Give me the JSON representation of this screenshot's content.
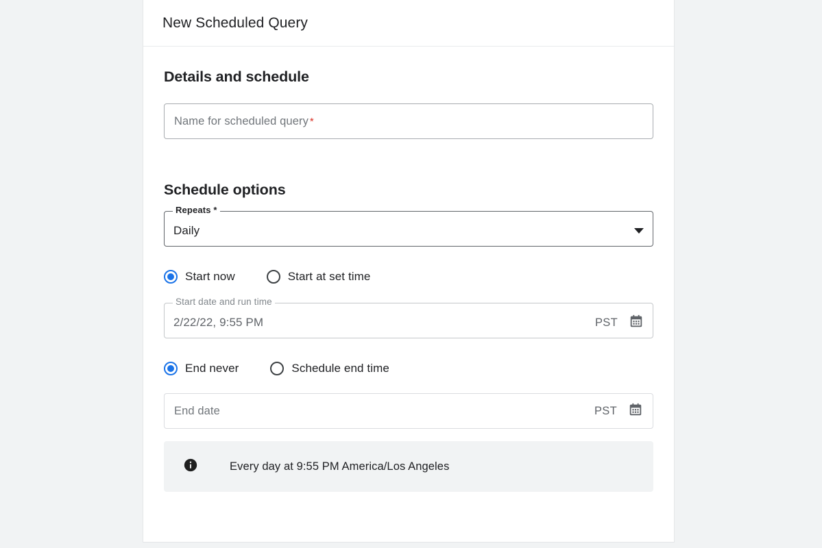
{
  "dialog": {
    "title": "New Scheduled Query"
  },
  "details": {
    "heading": "Details and schedule",
    "name_field": {
      "placeholder": "Name for scheduled query",
      "required_marker": "*",
      "value": ""
    }
  },
  "schedule": {
    "heading": "Schedule options",
    "repeats": {
      "label": "Repeats *",
      "value": "Daily",
      "caret_icon": "chevron-down-icon",
      "options": [
        "Daily"
      ]
    },
    "start_mode": {
      "selected": "start_now",
      "options": [
        {
          "id": "start_now",
          "label": "Start now",
          "checked": true
        },
        {
          "id": "start_at_set_time",
          "label": "Start at set time",
          "checked": false
        }
      ]
    },
    "start_datetime": {
      "label": "Start date and run time",
      "value": "2/22/22, 9:55 PM",
      "timezone": "PST",
      "calendar_icon": "calendar-icon",
      "disabled": true
    },
    "end_mode": {
      "selected": "end_never",
      "options": [
        {
          "id": "end_never",
          "label": "End never",
          "checked": true
        },
        {
          "id": "schedule_end_time",
          "label": "Schedule end time",
          "checked": false
        }
      ]
    },
    "end_date": {
      "placeholder": "End date",
      "value": "",
      "timezone": "PST",
      "calendar_icon": "calendar-icon"
    },
    "summary_banner": {
      "icon": "info-icon",
      "text": "Every day at 9:55 PM America/Los Angeles"
    }
  },
  "colors": {
    "accent_blue": "#1a73e8",
    "required_red": "#d93025",
    "panel_bg": "#ffffff",
    "page_bg": "#f1f3f4",
    "banner_bg": "#f1f3f4"
  }
}
